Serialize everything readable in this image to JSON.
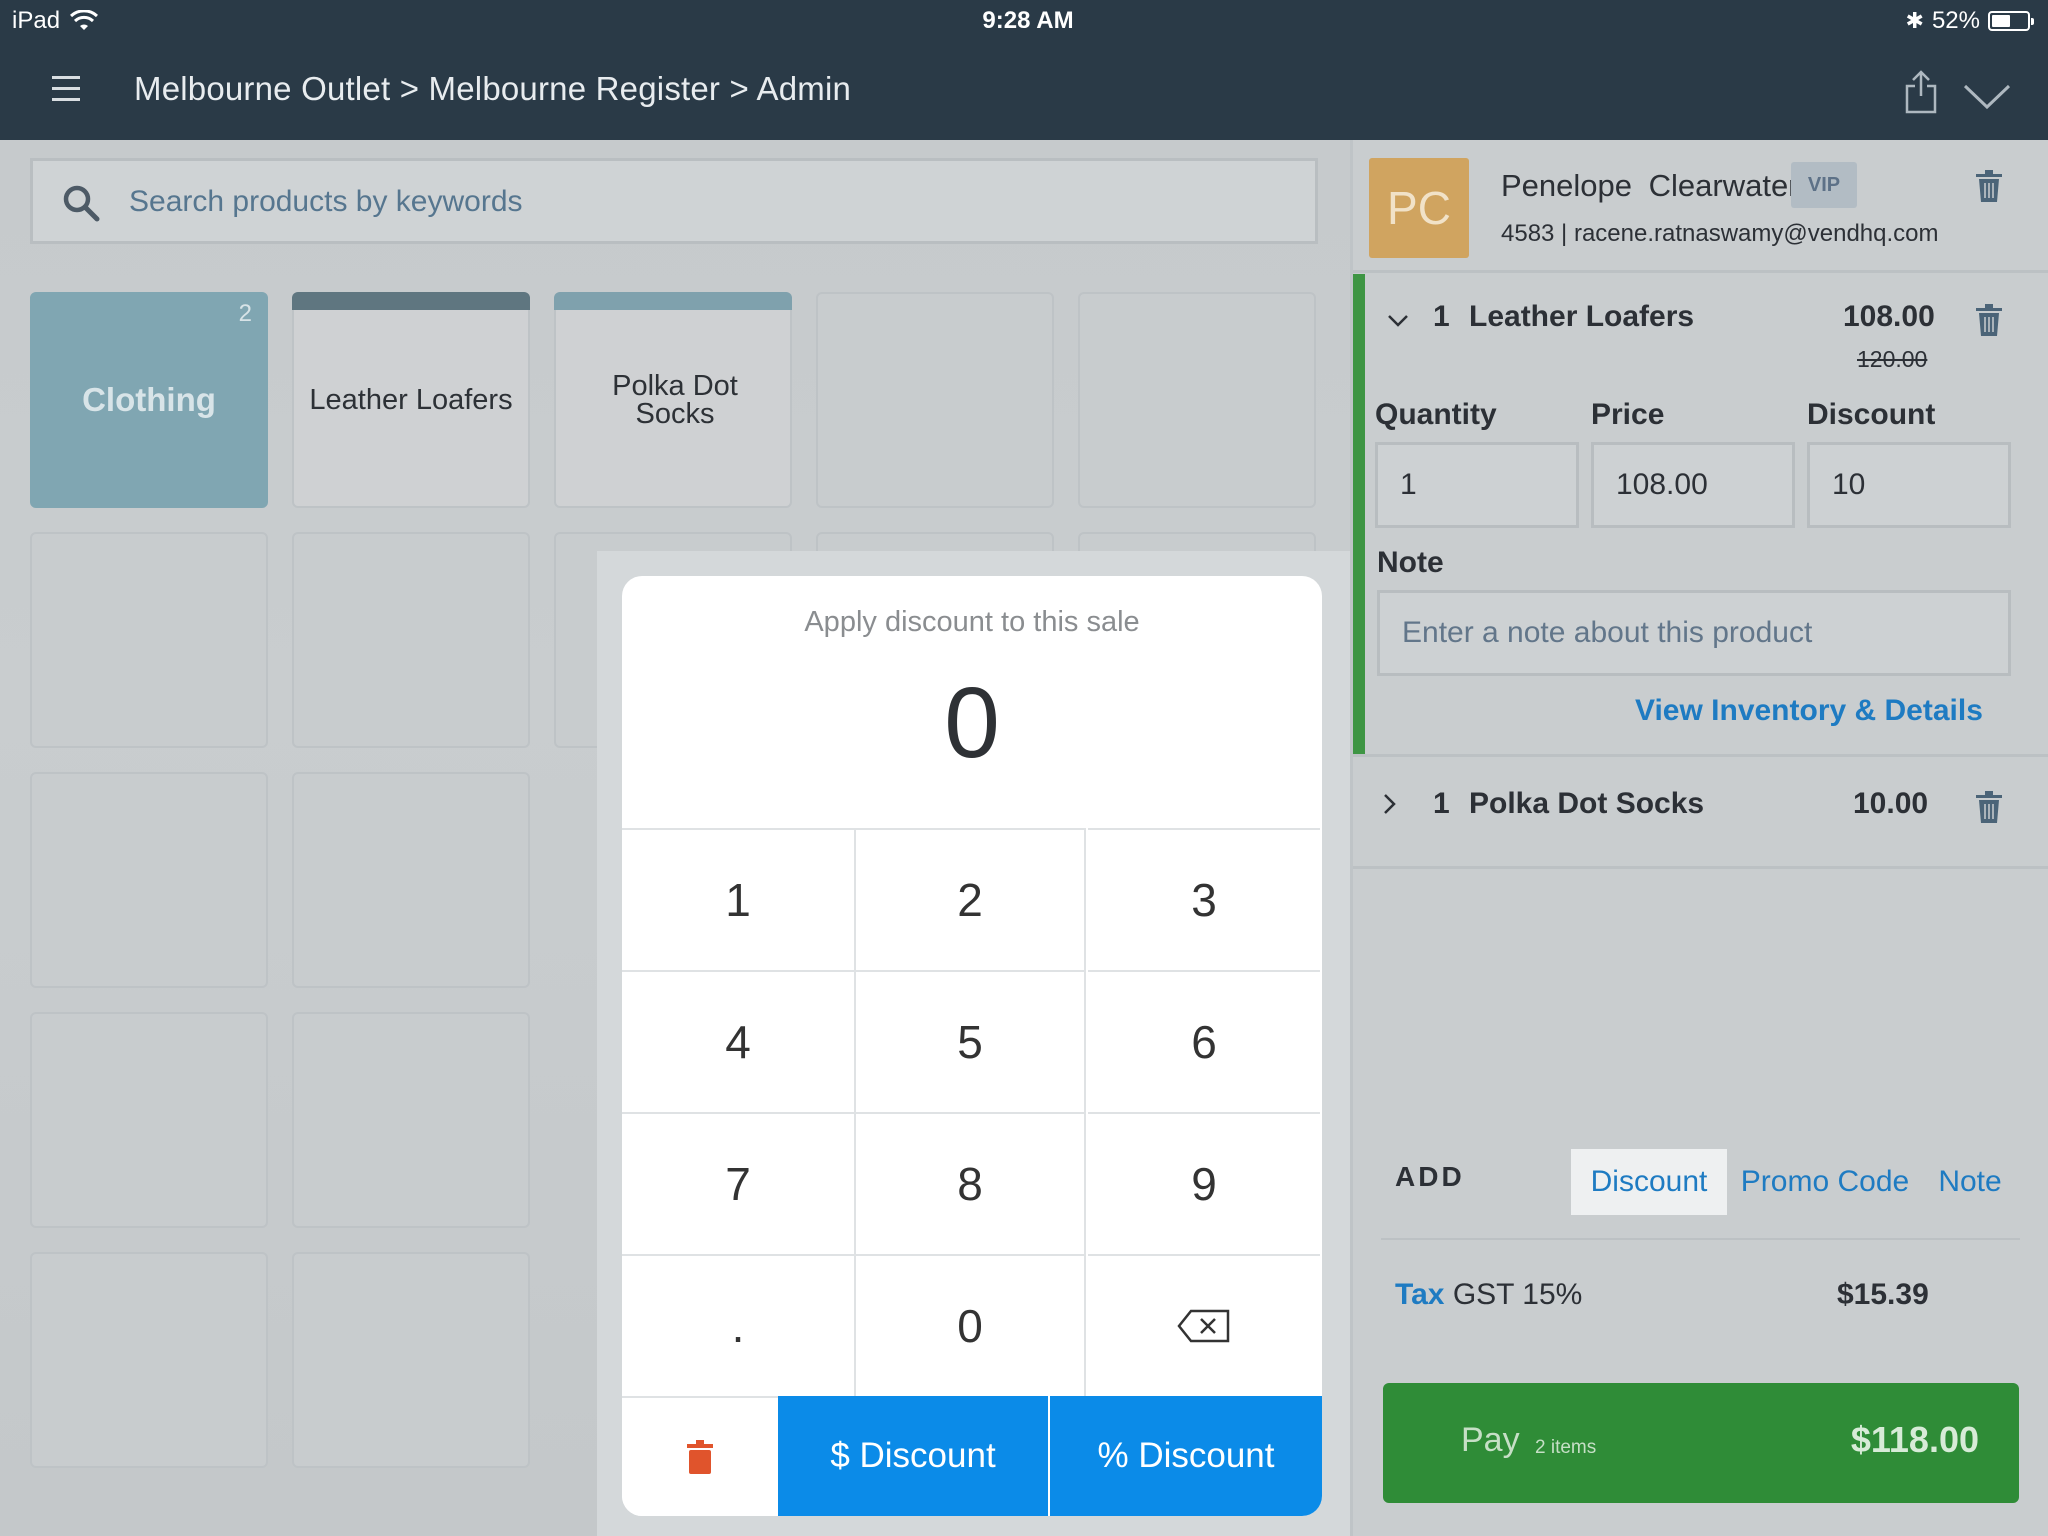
{
  "status_bar": {
    "device": "iPad",
    "time": "9:28 AM",
    "battery": "52%",
    "battery_level": 0.52
  },
  "header": {
    "breadcrumb": "Melbourne Outlet > Melbourne Register > Admin"
  },
  "search": {
    "placeholder": "Search products by keywords"
  },
  "tiles": [
    {
      "label": "Clothing",
      "type": "category",
      "count": "2"
    },
    {
      "label": "Leather Loafers",
      "type": "product",
      "bar_color": "#5f7680"
    },
    {
      "label": "Polka Dot Socks",
      "type": "product",
      "bar_color": "#7fa1ad"
    }
  ],
  "discount_pad": {
    "title": "Apply discount to this sale",
    "display": "0",
    "keys": [
      "1",
      "2",
      "3",
      "4",
      "5",
      "6",
      "7",
      "8",
      "9",
      ".",
      "0",
      "backspace-icon"
    ],
    "dollar_discount_label": "$ Discount",
    "percent_discount_label": "% Discount"
  },
  "customer": {
    "initials": "PC",
    "name": "Penelope  Clearwater",
    "badge": "VIP",
    "details": "4583 | racene.ratnaswamy@vendhq.com"
  },
  "line_items": [
    {
      "qty": "1",
      "name": "Leather Loafers",
      "price": "108.00",
      "original_price": "120.00",
      "expanded": true,
      "fields": {
        "quantity_label": "Quantity",
        "price_label": "Price",
        "discount_label": "Discount",
        "quantity": "1",
        "price": "108.00",
        "discount": "10",
        "note_label": "Note",
        "note_placeholder": "Enter a note about this product",
        "view_link": "View Inventory & Details"
      }
    },
    {
      "qty": "1",
      "name": "Polka Dot Socks",
      "price": "10.00",
      "expanded": false
    }
  ],
  "add_section": {
    "label": "ADD",
    "discount": "Discount",
    "promo_code": "Promo Code",
    "note": "Note"
  },
  "tax": {
    "link": "Tax",
    "label": "GST 15%",
    "amount": "$15.39"
  },
  "pay": {
    "label": "Pay",
    "items": "2 items",
    "amount": "$118.00"
  },
  "colors": {
    "header": "#2a3a47",
    "accent_blue": "#0b8be8",
    "pay_green": "#2f8c37",
    "line_item_accent": "#3e9544",
    "trash_red": "#e0542c"
  }
}
